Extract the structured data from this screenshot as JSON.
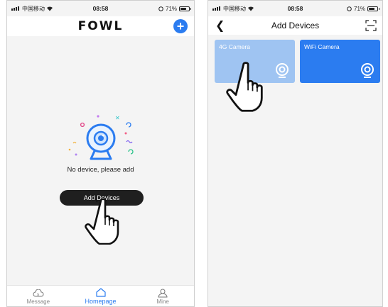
{
  "status_bar": {
    "carrier": "中国移动",
    "time": "08:58",
    "battery": "71%"
  },
  "screen_a": {
    "logo": "FOWL",
    "empty_text": "No device, please add",
    "add_button": "Add Devices",
    "tabs": [
      {
        "label": "Message",
        "icon": "cloud-icon"
      },
      {
        "label": "Homepage",
        "icon": "home-icon",
        "active": true
      },
      {
        "label": "Mine",
        "icon": "person-icon"
      }
    ]
  },
  "screen_b": {
    "title": "Add Devices",
    "cards": [
      {
        "label": "4G Camera",
        "icon": "camera-icon"
      },
      {
        "label": "WiFi Camera",
        "icon": "camera-icon"
      }
    ]
  },
  "colors": {
    "accent": "#2b7cf0",
    "card_light": "#9fc4f2",
    "button": "#1f1f1f"
  }
}
